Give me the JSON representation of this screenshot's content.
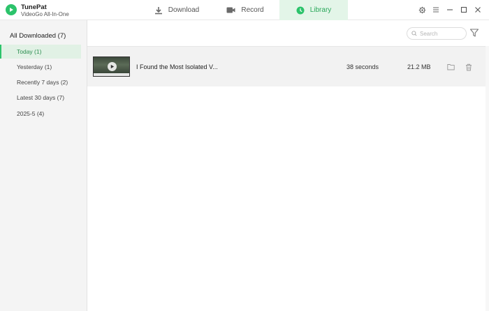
{
  "app": {
    "name": "TunePat",
    "subtitle": "VideoGo All-In-One",
    "accent_color": "#2cc36b"
  },
  "nav": {
    "tabs": [
      {
        "label": "Download",
        "icon": "download-icon",
        "active": false
      },
      {
        "label": "Record",
        "icon": "video-camera-icon",
        "active": false
      },
      {
        "label": "Library",
        "icon": "clock-icon",
        "active": true
      }
    ]
  },
  "window_controls": [
    "gear-icon",
    "menu-icon",
    "minimize-icon",
    "maximize-icon",
    "close-icon"
  ],
  "sidebar": {
    "header": "All Downloaded (7)",
    "items": [
      {
        "label": "Today (1)",
        "active": true
      },
      {
        "label": "Yesterday (1)",
        "active": false
      },
      {
        "label": "Recently 7 days (2)",
        "active": false
      },
      {
        "label": "Latest 30 days (7)",
        "active": false
      },
      {
        "label": "2025-5 (4)",
        "active": false
      }
    ]
  },
  "toolbar": {
    "search_placeholder": "Search",
    "filter_icon": "filter-icon"
  },
  "files": [
    {
      "title": "I Found the Most Isolated V...",
      "duration": "38 seconds",
      "size": "21.2 MB",
      "actions": [
        "folder-icon",
        "trash-icon"
      ]
    }
  ]
}
